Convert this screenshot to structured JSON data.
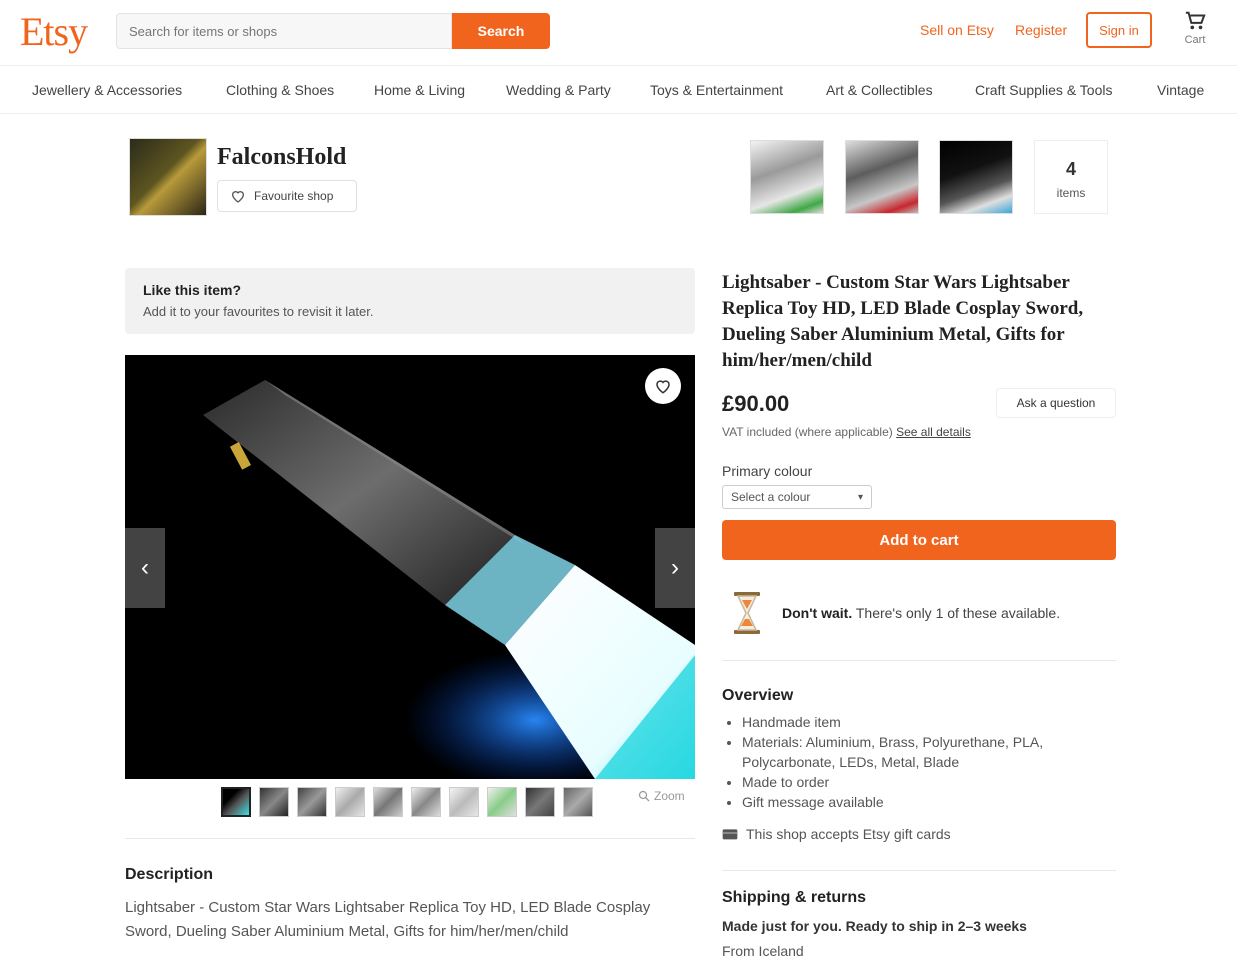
{
  "header": {
    "logo": "Etsy",
    "search_placeholder": "Search for items or shops",
    "search_button": "Search",
    "sell_link": "Sell on Etsy",
    "register_link": "Register",
    "signin_button": "Sign in",
    "cart_label": "Cart"
  },
  "categories": [
    "Jewellery & Accessories",
    "Clothing & Shoes",
    "Home & Living",
    "Wedding & Party",
    "Toys & Entertainment",
    "Art & Collectibles",
    "Craft Supplies & Tools",
    "Vintage"
  ],
  "shop": {
    "name": "FalconsHold",
    "favourite_button": "Favourite shop",
    "items_count": "4",
    "items_label": "items"
  },
  "banner": {
    "title": "Like this item?",
    "subtitle": "Add it to your favourites to revisit it later."
  },
  "gallery": {
    "zoom_label": "Zoom"
  },
  "listing": {
    "title": "Lightsaber - Custom Star Wars Lightsaber Replica Toy HD, LED Blade Cosplay Sword, Dueling Saber Aluminium Metal, Gifts for him/her/men/child",
    "price": "£90.00",
    "ask_button": "Ask a question",
    "vat_text": "VAT included (where applicable)",
    "vat_link": "See all details",
    "color_label": "Primary colour",
    "color_placeholder": "Select a colour",
    "add_to_cart": "Add to cart",
    "stock_bold": "Don't wait.",
    "stock_text": "There's only 1 of these available."
  },
  "overview": {
    "heading": "Overview",
    "items": [
      "Handmade item",
      "Materials: Aluminium, Brass, Polyurethane, PLA, Polycarbonate, LEDs, Metal, Blade",
      "Made to order",
      "Gift message available"
    ],
    "giftcards": "This shop accepts Etsy gift cards"
  },
  "shipping": {
    "heading": "Shipping & returns",
    "subheading": "Made just for you. Ready to ship in 2–3 weeks",
    "from": "From Iceland"
  },
  "description": {
    "heading": "Description",
    "text": "Lightsaber - Custom Star Wars Lightsaber Replica Toy HD, LED Blade Cosplay Sword, Dueling Saber Aluminium Metal, Gifts for him/her/men/child"
  },
  "colors": {
    "accent": "#F1641E",
    "blade": "#7FE9F2"
  }
}
